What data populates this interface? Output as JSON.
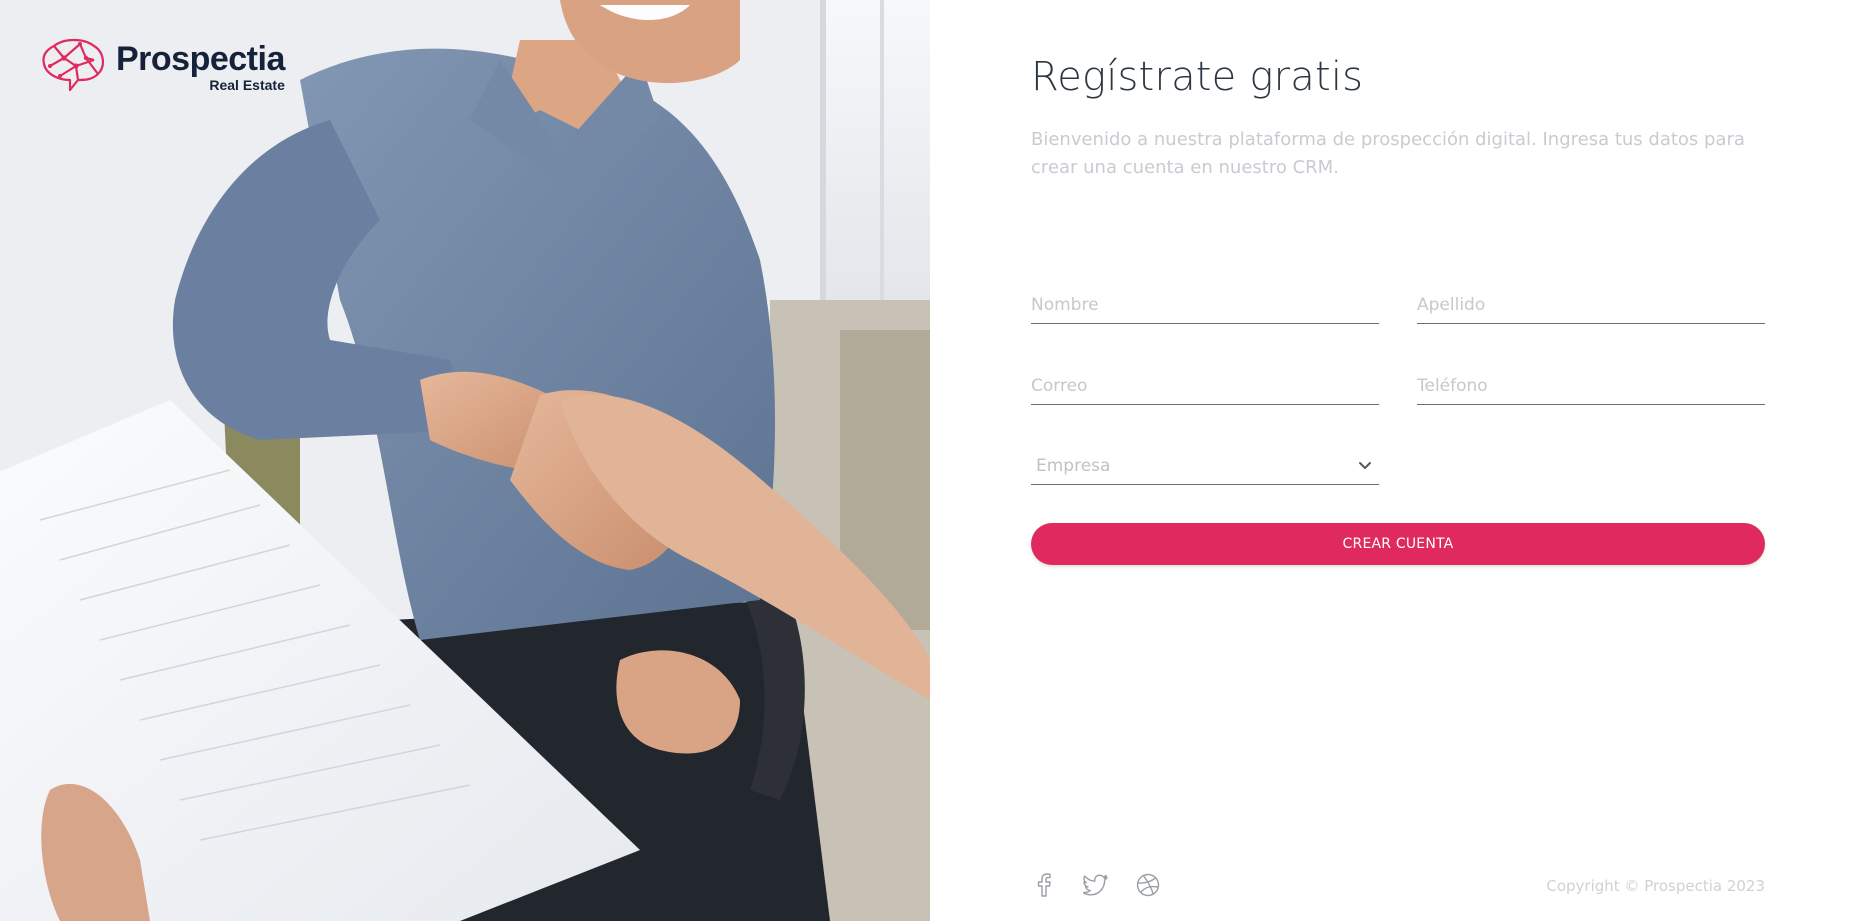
{
  "brand": {
    "name": "Prospectia",
    "tagline": "Real Estate",
    "logo_icon": "brain-network-icon",
    "accent_color": "#e02a5e",
    "text_color": "#16213a"
  },
  "hero": {
    "image": "business-handshake-photo"
  },
  "form": {
    "title": "Regístrate gratis",
    "subtitle": "Bienvenido a nuestra plataforma de prospección digital. Ingresa tus datos para crear una cuenta en nuestro CRM.",
    "fields": {
      "nombre": {
        "placeholder": "Nombre",
        "value": ""
      },
      "apellido": {
        "placeholder": "Apellido",
        "value": ""
      },
      "correo": {
        "placeholder": "Correo",
        "value": ""
      },
      "telefono": {
        "placeholder": "Teléfono",
        "value": ""
      }
    },
    "empresa": {
      "selected": "Empresa",
      "icon": "chevron-down-icon"
    },
    "submit_label": "CREAR CUENTA",
    "submit_color": "#e02a5e"
  },
  "footer": {
    "socials": [
      {
        "name": "facebook",
        "icon": "facebook-icon"
      },
      {
        "name": "twitter",
        "icon": "twitter-icon"
      },
      {
        "name": "dribbble",
        "icon": "dribbble-icon"
      }
    ],
    "copyright": "Copyright © Prospectia 2023"
  }
}
